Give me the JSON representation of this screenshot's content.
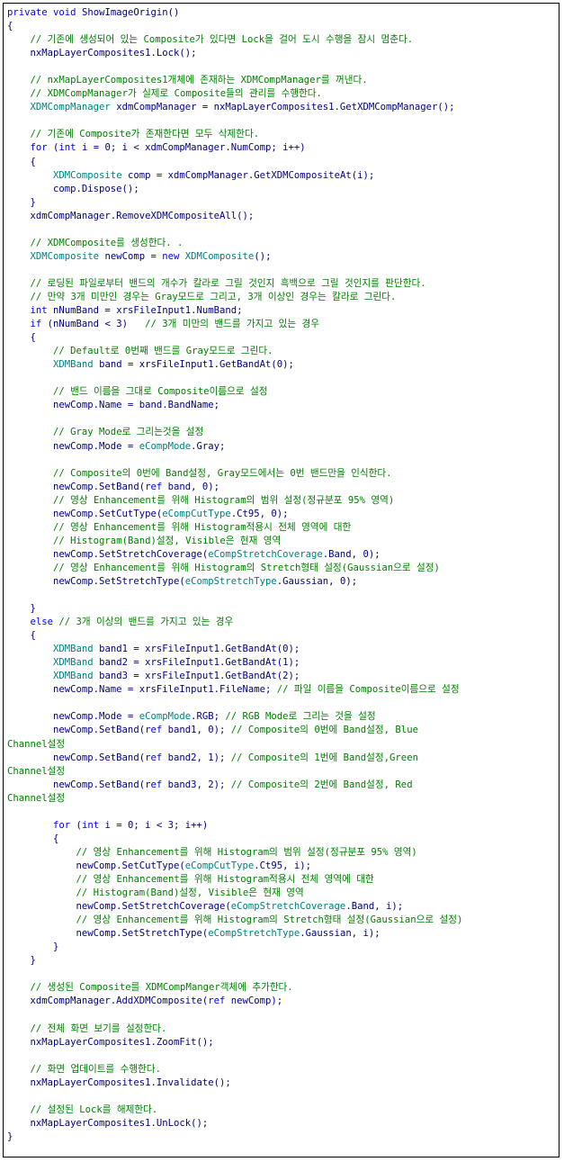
{
  "colors": {
    "plain": "#000080",
    "keyword": "#0000ff",
    "comment": "#008000",
    "class": "#008080",
    "border": "#000000"
  },
  "code_lines": [
    [
      [
        "kw",
        "private"
      ],
      [
        "p",
        " "
      ],
      [
        "kw",
        "void"
      ],
      [
        "p",
        " ShowImageOrigin()"
      ]
    ],
    [
      [
        "p",
        "{"
      ]
    ],
    [
      [
        "p",
        "    "
      ],
      [
        "cm",
        "// 기존에 생성되어 있는 Composite가 있다면 Lock을 걸어 도시 수행을 잠시 멈춘다."
      ]
    ],
    [
      [
        "p",
        "    nxMapLayerComposites1.Lock();"
      ]
    ],
    [
      [
        "p",
        ""
      ]
    ],
    [
      [
        "p",
        "    "
      ],
      [
        "cm",
        "// nxMapLayerComposites1개체에 존재하는 XDMCompManager를 꺼낸다."
      ]
    ],
    [
      [
        "p",
        "    "
      ],
      [
        "cm",
        "// XDMCompManager가 실제로 Composite들의 관리를 수행한다."
      ]
    ],
    [
      [
        "p",
        "    "
      ],
      [
        "cls",
        "XDMCompManager"
      ],
      [
        "p",
        " xdmCompManager = nxMapLayerComposites1.GetXDMCompManager();"
      ]
    ],
    [
      [
        "p",
        ""
      ]
    ],
    [
      [
        "p",
        "    "
      ],
      [
        "cm",
        "// 기존에 Composite가 존재한다면 모두 삭제한다."
      ]
    ],
    [
      [
        "p",
        "    "
      ],
      [
        "kw",
        "for"
      ],
      [
        "p",
        " ("
      ],
      [
        "kw",
        "int"
      ],
      [
        "p",
        " i = 0; i < xdmCompManager.NumComp; i++)"
      ]
    ],
    [
      [
        "p",
        "    {"
      ]
    ],
    [
      [
        "p",
        "        "
      ],
      [
        "cls",
        "XDMComposite"
      ],
      [
        "p",
        " comp = xdmCompManager.GetXDMCompositeAt(i);"
      ]
    ],
    [
      [
        "p",
        "        comp.Dispose();"
      ]
    ],
    [
      [
        "p",
        "    }"
      ]
    ],
    [
      [
        "p",
        "    xdmCompManager.RemoveXDMCompositeAll();"
      ]
    ],
    [
      [
        "p",
        ""
      ]
    ],
    [
      [
        "p",
        "    "
      ],
      [
        "cm",
        "// XDMComposite를 생성한다. ."
      ]
    ],
    [
      [
        "p",
        "    "
      ],
      [
        "cls",
        "XDMComposite"
      ],
      [
        "p",
        " newComp = "
      ],
      [
        "kw",
        "new"
      ],
      [
        "p",
        " "
      ],
      [
        "cls",
        "XDMComposite"
      ],
      [
        "p",
        "();"
      ]
    ],
    [
      [
        "p",
        ""
      ]
    ],
    [
      [
        "p",
        "    "
      ],
      [
        "cm",
        "// 로딩된 파일로부터 밴드의 개수가 칼라로 그릴 것인지 흑백으로 그릴 것인지를 판단한다."
      ]
    ],
    [
      [
        "p",
        "    "
      ],
      [
        "cm",
        "// 만약 3개 미만인 경우는 Gray모드로 그리고, 3개 이상인 경우는 칼라로 그린다."
      ]
    ],
    [
      [
        "p",
        "    "
      ],
      [
        "kw",
        "int"
      ],
      [
        "p",
        " nNumBand = xrsFileInput1.NumBand;"
      ]
    ],
    [
      [
        "p",
        "    "
      ],
      [
        "kw",
        "if"
      ],
      [
        "p",
        " (nNumBand < 3)   "
      ],
      [
        "cm",
        "// 3개 미만의 밴드를 가지고 있는 경우"
      ]
    ],
    [
      [
        "p",
        "    {"
      ]
    ],
    [
      [
        "p",
        "        "
      ],
      [
        "cm",
        "// Default로 0번째 밴드를 Gray모드로 그린다."
      ]
    ],
    [
      [
        "p",
        "        "
      ],
      [
        "cls",
        "XDMBand"
      ],
      [
        "p",
        " band = xrsFileInput1.GetBandAt(0);"
      ]
    ],
    [
      [
        "p",
        ""
      ]
    ],
    [
      [
        "p",
        "        "
      ],
      [
        "cm",
        "// 밴드 이름을 그대로 Composite이름으로 설정"
      ]
    ],
    [
      [
        "p",
        "        newComp.Name = band.BandName;"
      ]
    ],
    [
      [
        "p",
        ""
      ]
    ],
    [
      [
        "p",
        "        "
      ],
      [
        "cm",
        "// Gray Mode로 그리는것을 설정"
      ]
    ],
    [
      [
        "p",
        "        newComp.Mode = "
      ],
      [
        "cls",
        "eCompMode"
      ],
      [
        "p",
        ".Gray;"
      ]
    ],
    [
      [
        "p",
        ""
      ]
    ],
    [
      [
        "p",
        "        "
      ],
      [
        "cm",
        "// Composite의 0번에 Band설정, Gray모드에서는 0번 밴드만을 인식한다."
      ]
    ],
    [
      [
        "p",
        "        newComp.SetBand("
      ],
      [
        "kw",
        "ref"
      ],
      [
        "p",
        " band, 0);"
      ]
    ],
    [
      [
        "p",
        "        "
      ],
      [
        "cm",
        "// 영상 Enhancement를 위해 Histogram의 범위 설정(정규분포 95% 영역)"
      ]
    ],
    [
      [
        "p",
        "        newComp.SetCutType("
      ],
      [
        "cls",
        "eCompCutType"
      ],
      [
        "p",
        ".Ct95, 0);"
      ]
    ],
    [
      [
        "p",
        "        "
      ],
      [
        "cm",
        "// 영상 Enhancement를 위해 Histogram적용시 전체 영역에 대한"
      ]
    ],
    [
      [
        "p",
        "        "
      ],
      [
        "cm",
        "// Histogram(Band)설정, Visible은 현재 영역"
      ]
    ],
    [
      [
        "p",
        "        newComp.SetStretchCoverage("
      ],
      [
        "cls",
        "eCompStretchCoverage"
      ],
      [
        "p",
        ".Band, 0);"
      ]
    ],
    [
      [
        "p",
        "        "
      ],
      [
        "cm",
        "// 영상 Enhancement를 위해 Histogram의 Stretch형태 설정(Gaussian으로 설정)"
      ]
    ],
    [
      [
        "p",
        "        newComp.SetStretchType("
      ],
      [
        "cls",
        "eCompStretchType"
      ],
      [
        "p",
        ".Gaussian, 0);"
      ]
    ],
    [
      [
        "p",
        ""
      ]
    ],
    [
      [
        "p",
        "    }"
      ]
    ],
    [
      [
        "p",
        "    "
      ],
      [
        "kw",
        "else"
      ],
      [
        "p",
        " "
      ],
      [
        "cm",
        "// 3개 이상의 밴드를 가지고 있는 경우"
      ]
    ],
    [
      [
        "p",
        "    {"
      ]
    ],
    [
      [
        "p",
        "        "
      ],
      [
        "cls",
        "XDMBand"
      ],
      [
        "p",
        " band1 = xrsFileInput1.GetBandAt(0);"
      ]
    ],
    [
      [
        "p",
        "        "
      ],
      [
        "cls",
        "XDMBand"
      ],
      [
        "p",
        " band2 = xrsFileInput1.GetBandAt(1);"
      ]
    ],
    [
      [
        "p",
        "        "
      ],
      [
        "cls",
        "XDMBand"
      ],
      [
        "p",
        " band3 = xrsFileInput1.GetBandAt(2);"
      ]
    ],
    [
      [
        "p",
        "        newComp.Name = xrsFileInput1.FileName; "
      ],
      [
        "cm",
        "// 파일 이름을 Composite이름으로 설정"
      ]
    ],
    [
      [
        "p",
        ""
      ]
    ],
    [
      [
        "p",
        "        newComp.Mode = "
      ],
      [
        "cls",
        "eCompMode"
      ],
      [
        "p",
        ".RGB; "
      ],
      [
        "cm",
        "// RGB Mode로 그리는 것을 설정"
      ]
    ],
    [
      [
        "p",
        "        newComp.SetBand("
      ],
      [
        "kw",
        "ref"
      ],
      [
        "p",
        " band1, 0); "
      ],
      [
        "cm",
        "// Composite의 0번에 Band설정, Blue"
      ]
    ],
    [
      [
        "cm",
        "Channel설정"
      ]
    ],
    [
      [
        "p",
        "        newComp.SetBand("
      ],
      [
        "kw",
        "ref"
      ],
      [
        "p",
        " band2, 1); "
      ],
      [
        "cm",
        "// Composite의 1번에 Band설정,Green"
      ]
    ],
    [
      [
        "cm",
        "Channel설정"
      ]
    ],
    [
      [
        "p",
        "        newComp.SetBand("
      ],
      [
        "kw",
        "ref"
      ],
      [
        "p",
        " band3, 2); "
      ],
      [
        "cm",
        "// Composite의 2번에 Band설정, Red"
      ]
    ],
    [
      [
        "cm",
        "Channel설정"
      ]
    ],
    [
      [
        "p",
        ""
      ]
    ],
    [
      [
        "p",
        "        "
      ],
      [
        "kw",
        "for"
      ],
      [
        "p",
        " ("
      ],
      [
        "kw",
        "int"
      ],
      [
        "p",
        " i = 0; i < 3; i++)"
      ]
    ],
    [
      [
        "p",
        "        {"
      ]
    ],
    [
      [
        "p",
        "            "
      ],
      [
        "cm",
        "// 영상 Enhancement를 위해 Histogram의 범위 설정(정규분포 95% 영역)"
      ]
    ],
    [
      [
        "p",
        "            newComp.SetCutType("
      ],
      [
        "cls",
        "eCompCutType"
      ],
      [
        "p",
        ".Ct95, i);"
      ]
    ],
    [
      [
        "p",
        "            "
      ],
      [
        "cm",
        "// 영상 Enhancement를 위해 Histogram적용시 전체 영역에 대한"
      ]
    ],
    [
      [
        "p",
        "            "
      ],
      [
        "cm",
        "// Histogram(Band)설정, Visible은 현재 영역"
      ]
    ],
    [
      [
        "p",
        "            newComp.SetStretchCoverage("
      ],
      [
        "cls",
        "eCompStretchCoverage"
      ],
      [
        "p",
        ".Band, i);"
      ]
    ],
    [
      [
        "p",
        "            "
      ],
      [
        "cm",
        "// 영상 Enhancement를 위해 Histogram의 Stretch형태 설정(Gaussian으로 설정)"
      ]
    ],
    [
      [
        "p",
        "            newComp.SetStretchType("
      ],
      [
        "cls",
        "eCompStretchType"
      ],
      [
        "p",
        ".Gaussian, i);"
      ]
    ],
    [
      [
        "p",
        "        }"
      ]
    ],
    [
      [
        "p",
        "    }"
      ]
    ],
    [
      [
        "p",
        ""
      ]
    ],
    [
      [
        "p",
        "    "
      ],
      [
        "cm",
        "// 생성된 Composite를 XDMCompManger객체에 추가한다."
      ]
    ],
    [
      [
        "p",
        "    xdmCompManager.AddXDMComposite("
      ],
      [
        "kw",
        "ref"
      ],
      [
        "p",
        " newComp);"
      ]
    ],
    [
      [
        "p",
        ""
      ]
    ],
    [
      [
        "p",
        "    "
      ],
      [
        "cm",
        "// 전체 화면 보기를 설정한다."
      ]
    ],
    [
      [
        "p",
        "    nxMapLayerComposites1.ZoomFit();"
      ]
    ],
    [
      [
        "p",
        ""
      ]
    ],
    [
      [
        "p",
        "    "
      ],
      [
        "cm",
        "// 화면 업데이트를 수행한다."
      ]
    ],
    [
      [
        "p",
        "    nxMapLayerComposites1.Invalidate();"
      ]
    ],
    [
      [
        "p",
        ""
      ]
    ],
    [
      [
        "p",
        "    "
      ],
      [
        "cm",
        "// 설정된 Lock를 해제한다."
      ]
    ],
    [
      [
        "p",
        "    nxMapLayerComposites1.UnLock();"
      ]
    ],
    [
      [
        "p",
        "}"
      ]
    ]
  ]
}
